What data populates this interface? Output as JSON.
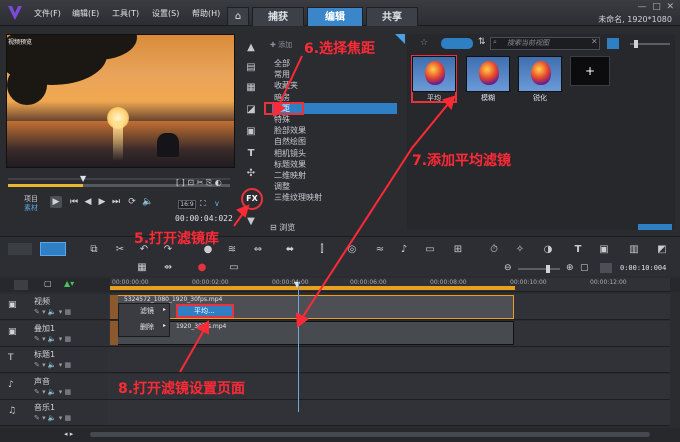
{
  "menu": [
    "文件(F)",
    "编辑(E)",
    "工具(T)",
    "设置(S)",
    "帮助(H)"
  ],
  "tabs": [
    "捕获",
    "编辑",
    "共享"
  ],
  "active_tab": "编辑",
  "doc_info": "未命名, 1920*1080",
  "preview_label": "视频预览",
  "preview_labels": [
    "项目",
    "素材"
  ],
  "timecode": "00:00:04:022",
  "categories": [
    "全部",
    "常用",
    "收藏夹",
    "暗房",
    "焦距",
    "特殊",
    "脸部效果",
    "自然绘图",
    "相机镜头",
    "标题效果",
    "二维映射",
    "调整",
    "三维纹理映射"
  ],
  "selected_category": "焦距",
  "browse_label": "浏览",
  "add_label": "添加",
  "search_placeholder": "搜索当前视图",
  "filters": [
    "平均",
    "模糊",
    "锐化"
  ],
  "ruler_labels": [
    "00:00:00:00",
    "00:00:02:00",
    "00:00:04:00",
    "00:00:06:00",
    "00:00:08:00",
    "00:00:10:00",
    "00:00:12:00"
  ],
  "zoom_time": "0:00:10:004",
  "tracks": [
    "视频",
    "叠加1",
    "标题1",
    "声音",
    "音乐1"
  ],
  "clip_names": [
    "5324572_1080_1920_30fps.mp4",
    "1920_30fps.mp4"
  ],
  "context_menu": [
    "滤镜",
    "删除"
  ],
  "submenu_item": "平均...",
  "annotations": {
    "a5": "5.打开滤镜库",
    "a6": "6.选择焦距",
    "a7": "7.添加平均滤镜",
    "a8": "8.打开滤镜设置页面"
  },
  "colors": {
    "accent": "#2f7fc4",
    "annotation": "#ff2a36",
    "highlight_clip": "#e8a020"
  }
}
